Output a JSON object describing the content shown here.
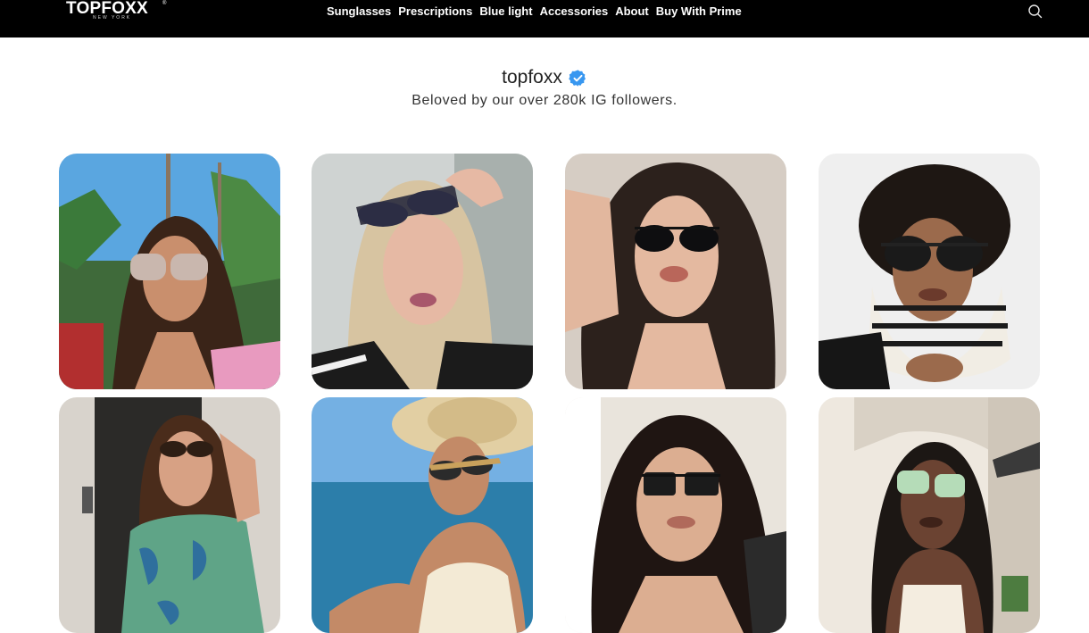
{
  "brand": {
    "logo_text": "TOPFOXX",
    "logo_mark": "®",
    "logo_subtext": "NEW YORK"
  },
  "nav": {
    "items": [
      {
        "label": "Sunglasses"
      },
      {
        "label": "Prescriptions"
      },
      {
        "label": "Blue light"
      },
      {
        "label": "Accessories"
      },
      {
        "label": "About"
      },
      {
        "label": "Buy With Prime"
      }
    ],
    "search_icon": "search-icon"
  },
  "instagram": {
    "handle": "topfoxx",
    "verified_icon": "verified-badge-icon",
    "tagline": "Beloved by our over 280k IG followers."
  },
  "gallery": {
    "photos": [
      {
        "alt": "Woman with rimless gradient sunglasses under palm trees"
      },
      {
        "alt": "Blonde woman holding aviator sunglasses on her head"
      },
      {
        "alt": "Dark-haired woman in black aviator sunglasses"
      },
      {
        "alt": "Curly-haired woman in oversized black sunglasses and striped scarf"
      },
      {
        "alt": "Woman in floral shirt wearing brown sunglasses"
      },
      {
        "alt": "Woman in straw hat wearing tortoise cat-eye sunglasses by the sea"
      },
      {
        "alt": "Woman in slim rectangular black sunglasses"
      },
      {
        "alt": "Woman in mint green square sunglasses"
      }
    ]
  },
  "colors": {
    "topbar": "#000000",
    "verified_badge": "#3897f0",
    "page_bg": "#ffffff"
  }
}
